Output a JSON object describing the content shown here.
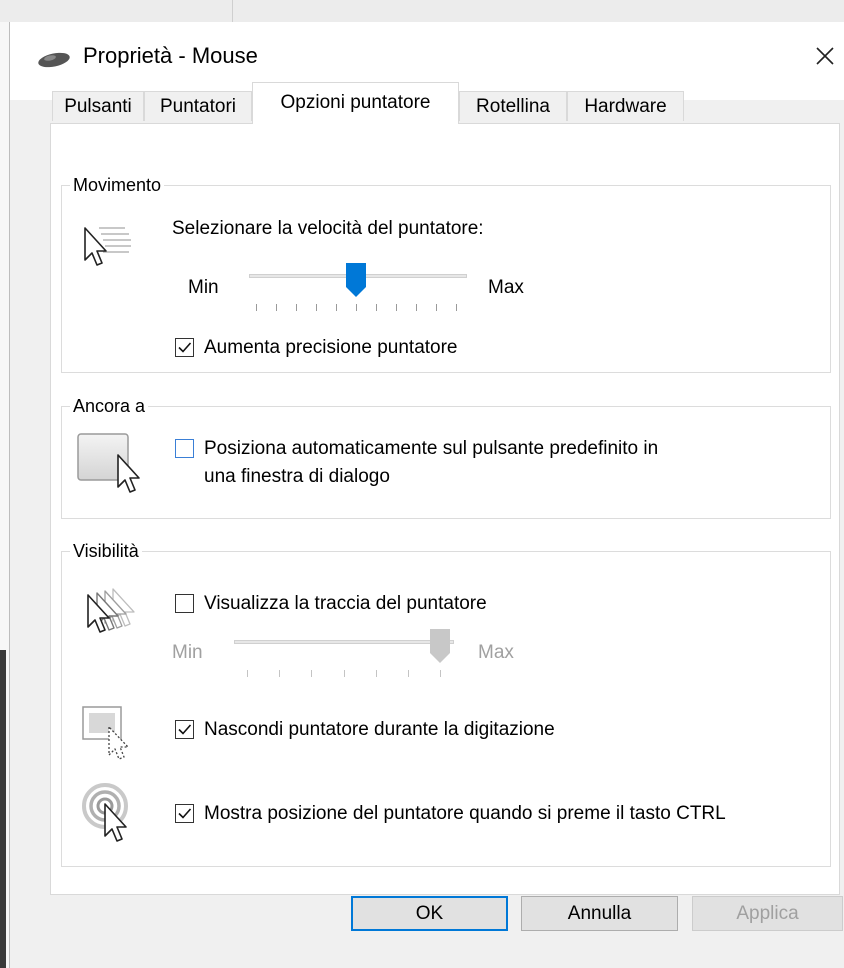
{
  "window": {
    "title": "Proprietà - Mouse",
    "title_icon": "mouse-icon",
    "close_glyph": "✕"
  },
  "tabs": [
    {
      "label": "Pulsanti",
      "active": false
    },
    {
      "label": "Puntatori",
      "active": false
    },
    {
      "label": "Opzioni puntatore",
      "active": true
    },
    {
      "label": "Rotellina",
      "active": false
    },
    {
      "label": "Hardware",
      "active": false
    }
  ],
  "movimento": {
    "group_label": "Movimento",
    "speed_label": "Selezionare la velocità del puntatore:",
    "min_label": "Min",
    "max_label": "Max",
    "speed_value": 0.5,
    "precision_label": "Aumenta precisione puntatore",
    "precision_checked": true
  },
  "ancora": {
    "group_label": "Ancora a",
    "snap_label_line1": "Posiziona automaticamente sul pulsante predefinito in",
    "snap_label_line2": "una finestra di dialogo",
    "snap_checked": false
  },
  "visibilita": {
    "group_label": "Visibilità",
    "trails_label": "Visualizza la traccia del puntatore",
    "trails_checked": false,
    "trails_min_label": "Min",
    "trails_max_label": "Max",
    "trails_value": 1.0,
    "hide_label": "Nascondi puntatore durante la digitazione",
    "hide_checked": true,
    "show_location_label": "Mostra posizione del puntatore quando si preme il tasto CTRL",
    "show_location_checked": true
  },
  "buttons": {
    "ok": "OK",
    "cancel": "Annulla",
    "apply": "Applica"
  },
  "colors": {
    "accent": "#0078d7",
    "focus_checkbox": "#3a7fd6",
    "disabled_text": "#a0a0a0"
  }
}
